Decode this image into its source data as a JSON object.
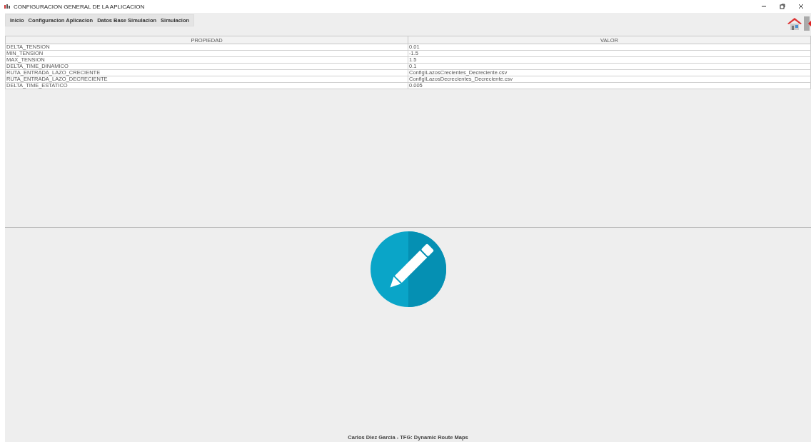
{
  "window": {
    "title": "CONFIGURACION GENERAL DE LA APLICACION"
  },
  "menu": [
    "Inicio",
    "Configuracion Aplicacion",
    "Datos Base Simulacion",
    "Simulacion"
  ],
  "table": {
    "columns": [
      "PROPIEDAD",
      "VALOR"
    ],
    "rows": [
      [
        "DELTA_TENSION",
        "0.01"
      ],
      [
        "MIN_TENSION",
        "-1.5"
      ],
      [
        "MAX_TENSION",
        "1.5"
      ],
      [
        "DELTA_TIME_DINAMICO",
        "0.1"
      ],
      [
        "RUTA_ENTRADA_LAZO_CRECIENTE",
        "Config\\LazosCrecientes_Decreciente.csv"
      ],
      [
        "RUTA_ENTRADA_LAZO_DECRECIENTE",
        "Config\\LazosDecrecientes_Decreciente.csv"
      ],
      [
        "DELTA_TIME_ESTATICO",
        "0.005"
      ]
    ]
  },
  "footer": "Carlos Diez Garcia - TFG: Dynamic Route Maps"
}
